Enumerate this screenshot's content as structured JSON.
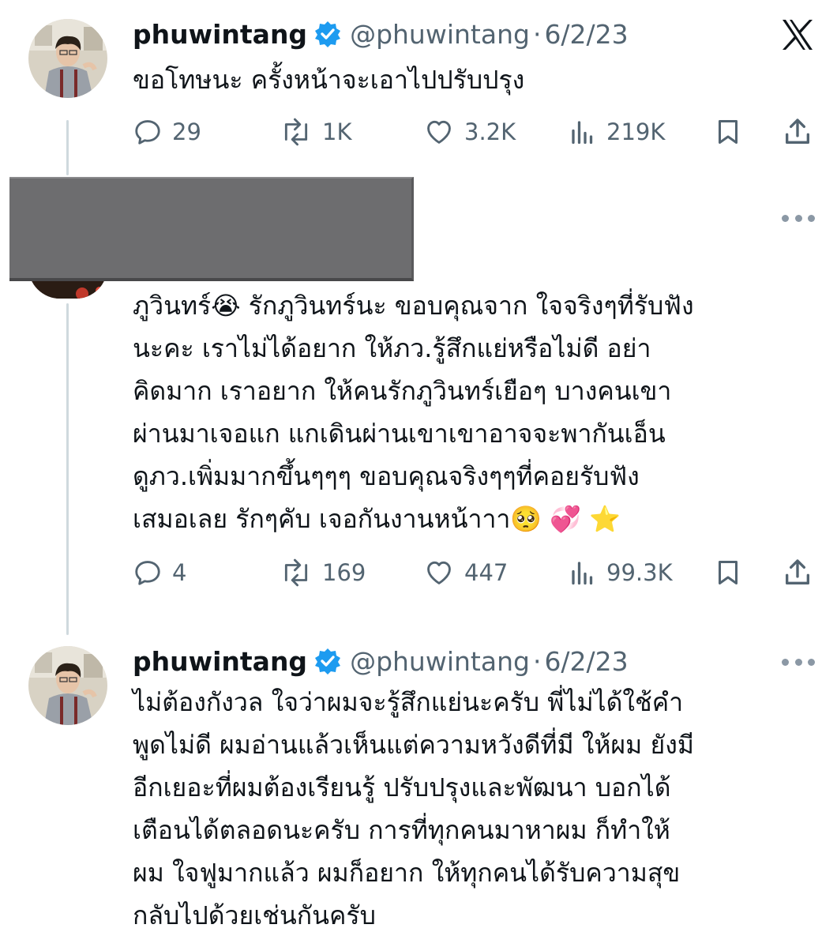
{
  "brand": {
    "logo_icon": "x-logo-icon"
  },
  "colors": {
    "verified": "#1d9bf0",
    "muted": "#536471",
    "line": "#cfd9de"
  },
  "tweet1": {
    "name": "phuwintang",
    "handle": "@phuwintang",
    "separator": "·",
    "date": "6/2/23",
    "text_lines": [
      "ขอโทษนะ ครั้งหน้าจะเอาไปปรับปรุง"
    ],
    "stats": {
      "replies": "29",
      "reposts": "1K",
      "likes": "3.2K",
      "views": "219K"
    }
  },
  "tweet2": {
    "text_lines": [
      "ภูวินทร์😭 รักภูวินทร์นะ ขอบคุณจาก ใจจริงๆที่รับฟัง",
      "นะคะ เราไม่ได้อยาก ให้ภว.รู้สึกแย่หรือไม่ดี อย่า",
      "คิดมาก เราอยาก ให้คนรักภูวินทร์เยือๆ บางคนเขา",
      "ผ่านมาเจอแก แกเดินผ่านเขาเขาอาจจะพากันเอ็น",
      "ดูภว.เพิ่มมากขึ้นๆๆๆ ขอบคุณจริงๆๆที่คอยรับฟัง",
      "เสมอเลย รักๆคับ เจอกันงานหน้าาา🥺 💞 ⭐"
    ],
    "stats": {
      "replies": "4",
      "reposts": "169",
      "likes": "447",
      "views": "99.3K"
    }
  },
  "tweet3": {
    "name": "phuwintang",
    "handle": "@phuwintang",
    "separator": "·",
    "date": "6/2/23",
    "text_lines": [
      "ไม่ต้องกังวล ใจว่าผมจะรู้สึกแย่นะครับ พี่ไม่ได้ใช้คำ",
      "พูดไม่ดี ผมอ่านแล้วเห็นแต่ความหวังดีที่มี ให้ผม ยังมี",
      "อีกเยอะที่ผมต้องเรียนรู้ ปรับปรุงและพัฒนา บอกได้",
      "เตือนได้ตลอดนะครับ การที่ทุกคนมาหาผม ก็ทำให้",
      "ผม ใจฟูมากแล้ว ผมก็อยาก ให้ทุกคนได้รับความสุข",
      "กลับไปด้วยเช่นกันครับ"
    ]
  }
}
